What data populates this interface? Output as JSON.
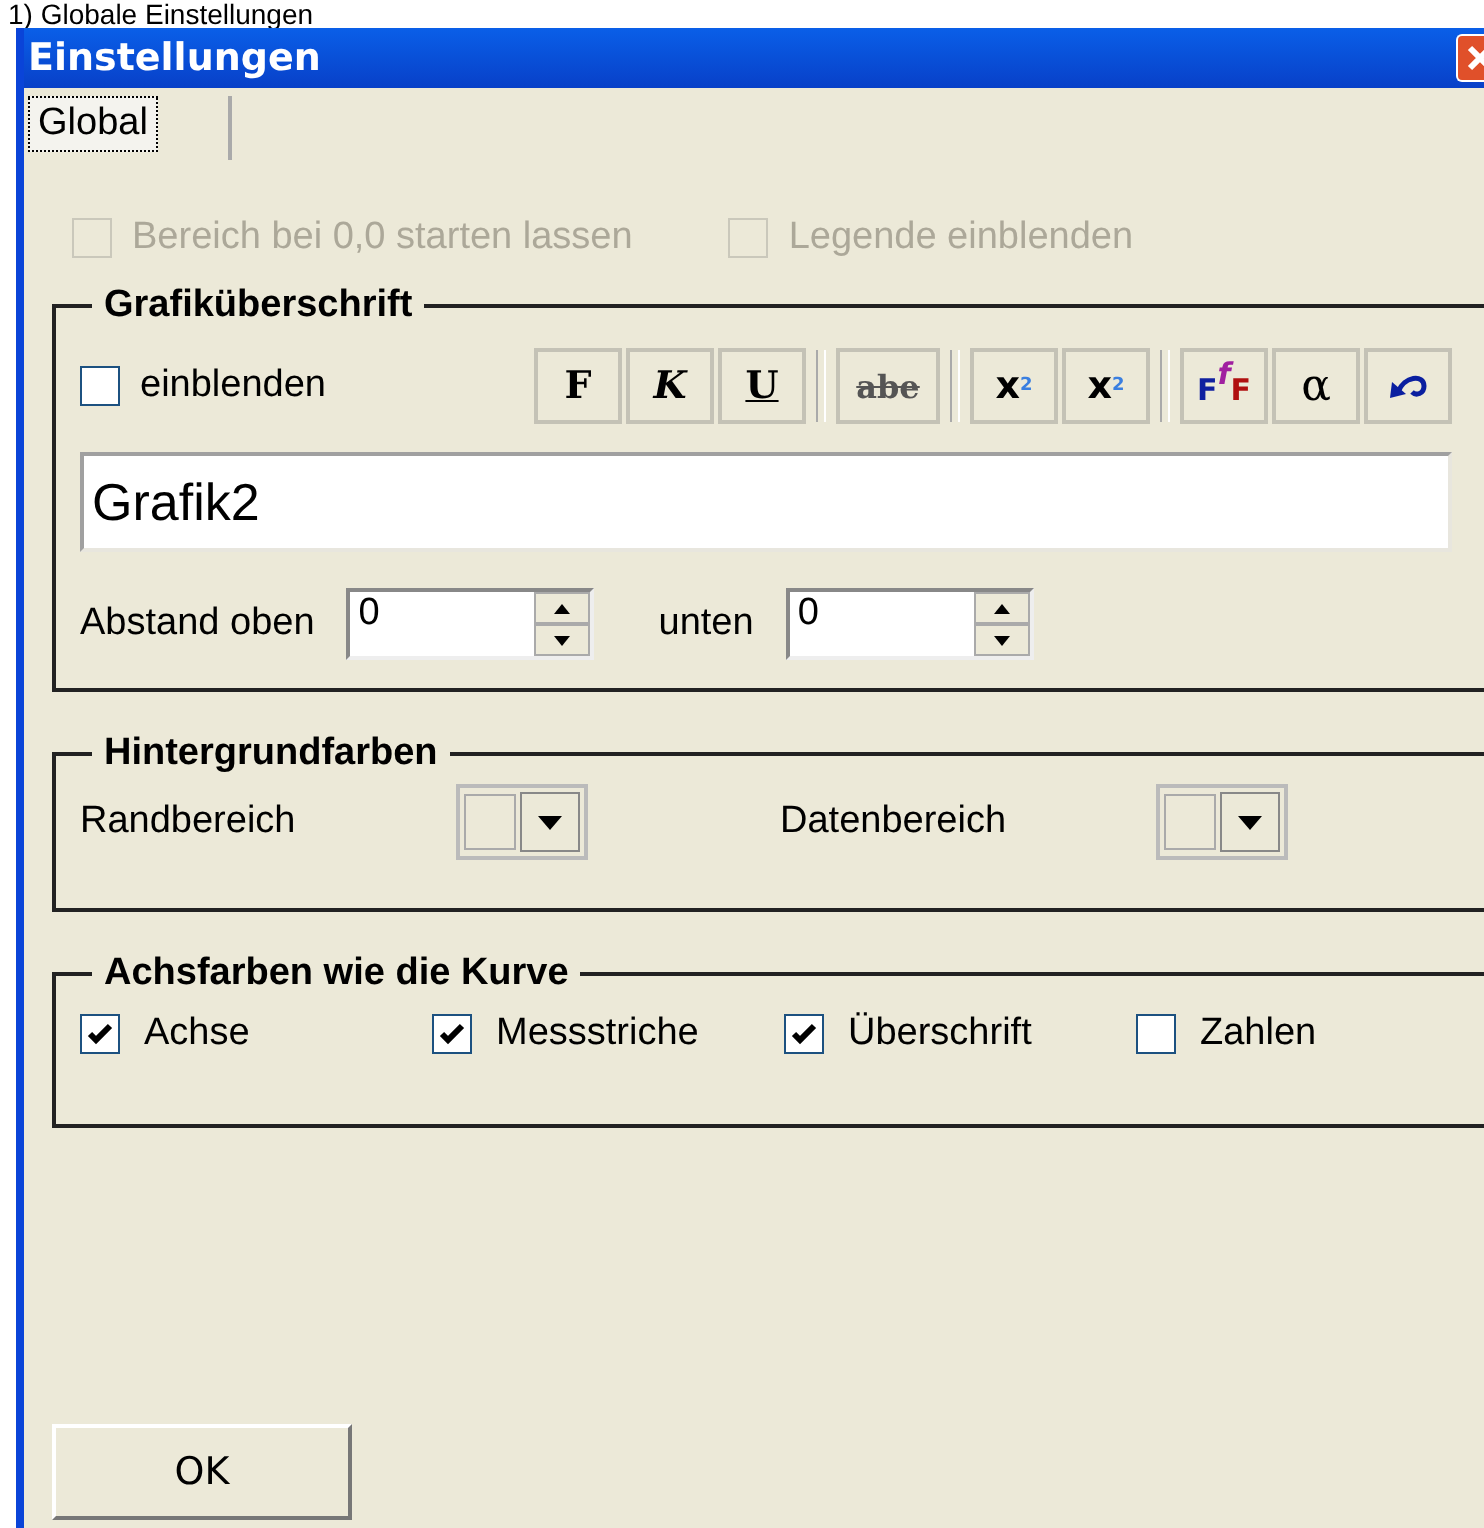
{
  "caption": "1) Globale Einstellungen",
  "window": {
    "title": "Einstellungen"
  },
  "tabs": [
    {
      "label": "Global",
      "selected": true
    }
  ],
  "options": [
    {
      "label": "Bereich bei 0,0 starten lassen",
      "checked": false,
      "disabled": true
    },
    {
      "label": "Legende einblenden",
      "checked": false,
      "disabled": true
    }
  ],
  "title_group": {
    "heading": "Grafiküberschrift",
    "show": {
      "label": "einblenden",
      "checked": false
    },
    "toolbar": [
      [
        {
          "kind": "bold",
          "label": "F"
        },
        {
          "kind": "italic",
          "label": "K"
        },
        {
          "kind": "underline",
          "label": "U"
        }
      ],
      [
        {
          "kind": "strike",
          "label": "abe"
        }
      ],
      [
        {
          "kind": "superscript",
          "label": "x",
          "mark": "2"
        },
        {
          "kind": "subscript",
          "label": "x",
          "mark": "2"
        }
      ],
      [
        {
          "kind": "font",
          "parts": [
            "F",
            "f",
            "F"
          ]
        },
        {
          "kind": "symbol",
          "label": "α"
        },
        {
          "kind": "undo"
        }
      ]
    ],
    "text": "Grafik2",
    "spacing": [
      {
        "label": "Abstand oben",
        "value": "0"
      },
      {
        "label": "unten",
        "value": "0"
      }
    ]
  },
  "background_group": {
    "heading": "Hintergrundfarben",
    "pickers": [
      {
        "label": "Randbereich",
        "color": "#ece9d8"
      },
      {
        "label": "Datenbereich",
        "color": "#ece9d8"
      }
    ]
  },
  "axis_group": {
    "heading": "Achsfarben wie die Kurve",
    "items": [
      {
        "label": "Achse",
        "checked": true
      },
      {
        "label": "Messstriche",
        "checked": true
      },
      {
        "label": "Überschrift",
        "checked": true
      },
      {
        "label": "Zahlen",
        "checked": false
      }
    ]
  },
  "buttons": [
    "OK"
  ]
}
